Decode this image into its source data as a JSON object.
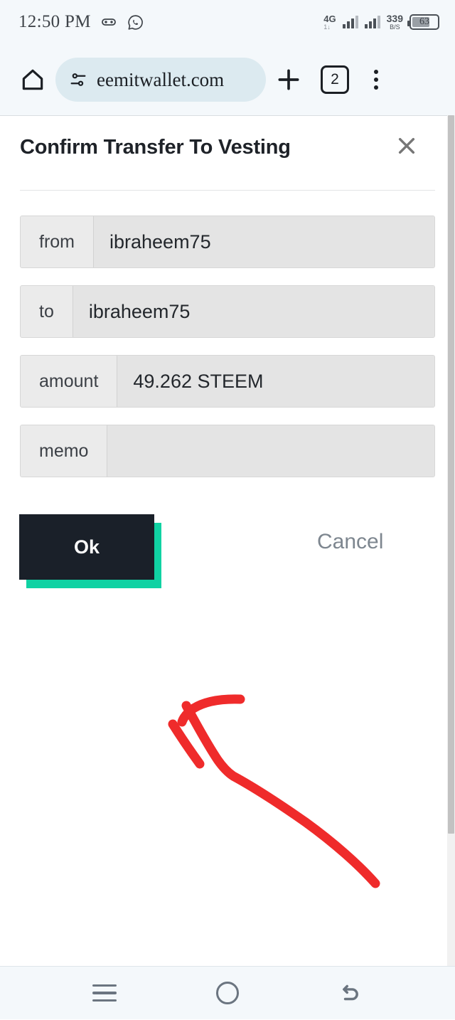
{
  "status_bar": {
    "time": "12:50 PM",
    "left_icons": [
      "gamepad-icon",
      "whatsapp-icon"
    ],
    "network_type": "4G",
    "network_sub": "1↓",
    "data_speed_value": "339",
    "data_speed_unit": "B/S",
    "battery_percent": "63",
    "background": "#f4f8fb"
  },
  "browser": {
    "home_icon": "home-icon",
    "site_settings_icon": "site-settings-icon",
    "url": "eemitwallet.com",
    "new_tab_icon": "plus-icon",
    "tab_count": "2",
    "menu_icon": "overflow-menu-icon",
    "omnibox_background": "#dceaf0"
  },
  "dialog": {
    "title": "Confirm Transfer To Vesting",
    "close_icon": "close-icon",
    "fields": [
      {
        "label": "from",
        "value": "ibraheem75"
      },
      {
        "label": "to",
        "value": "ibraheem75"
      },
      {
        "label": "amount",
        "value": "49.262 STEEM"
      },
      {
        "label": "memo",
        "value": ""
      }
    ],
    "ok_label": "Ok",
    "cancel_label": "Cancel",
    "ok_background": "#1a2029",
    "ok_shadow_color": "#10d2a3",
    "cancel_color": "#7d868f"
  },
  "annotation": {
    "type": "hand-drawn-arrow",
    "color": "#ef2b2b",
    "points_to": "ok-button"
  },
  "nav_bar": {
    "items": [
      {
        "name": "recents-button",
        "icon": "hamburger-icon"
      },
      {
        "name": "home-button",
        "icon": "circle-icon"
      },
      {
        "name": "back-button",
        "icon": "back-arrow-icon"
      }
    ],
    "background": "#f4f8fb"
  }
}
